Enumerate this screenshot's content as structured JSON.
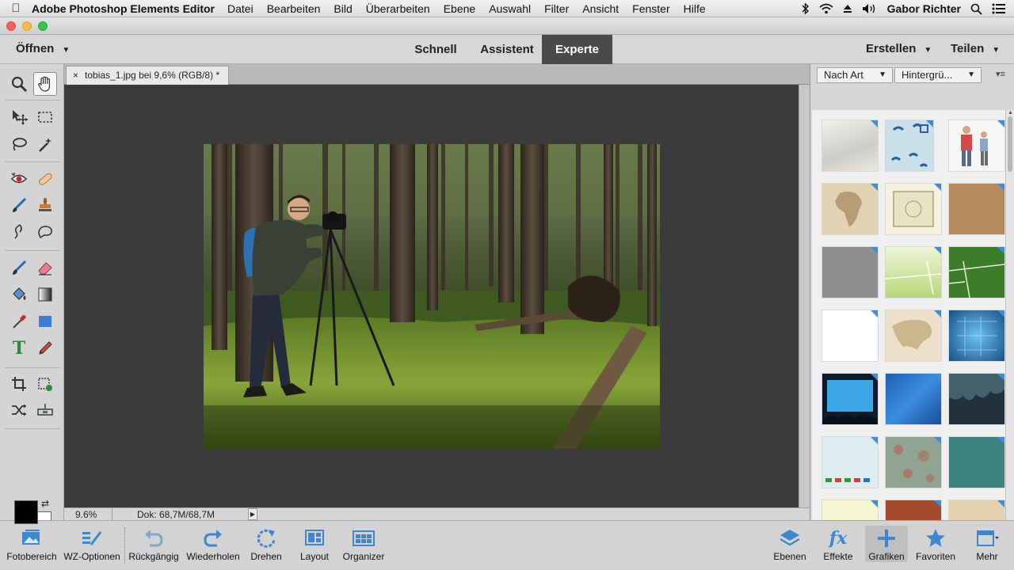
{
  "menubar": {
    "apple": "",
    "app_name": "Adobe Photoshop Elements Editor",
    "items": [
      "Datei",
      "Bearbeiten",
      "Bild",
      "Überarbeiten",
      "Ebene",
      "Auswahl",
      "Filter",
      "Ansicht",
      "Fenster",
      "Hilfe"
    ],
    "user": "Gabor Richter"
  },
  "modebar": {
    "open_label": "Öffnen",
    "modes": [
      "Schnell",
      "Assistent",
      "Experte"
    ],
    "active_mode": "Experte",
    "create_label": "Erstellen",
    "share_label": "Teilen"
  },
  "document": {
    "tab_label": "tobias_1.jpg bei 9,6% (RGB/8) *",
    "close_glyph": "×"
  },
  "statusbar": {
    "zoom": "9.6%",
    "doc_size": "Dok: 68,7M/68,7M"
  },
  "panel": {
    "sort_dropdown": "Nach Art",
    "category_dropdown": "Hintergrü..."
  },
  "bottombar": {
    "fotobereich": "Fotobereich",
    "wz_optionen": "WZ-Optionen",
    "undo": "Rückgängig",
    "redo": "Wiederholen",
    "rotate": "Drehen",
    "layout": "Layout",
    "organizer": "Organizer",
    "layers": "Ebenen",
    "effects": "Effekte",
    "graphics": "Grafiken",
    "favorites": "Favoriten",
    "more": "Mehr",
    "active": "Grafiken"
  },
  "colors": {
    "foreground": "#000000",
    "background": "#ffffff",
    "accent_blue": "#3b8fd6",
    "active_mode_bg": "#4a4a4a"
  },
  "tool_text_glyph": "T"
}
